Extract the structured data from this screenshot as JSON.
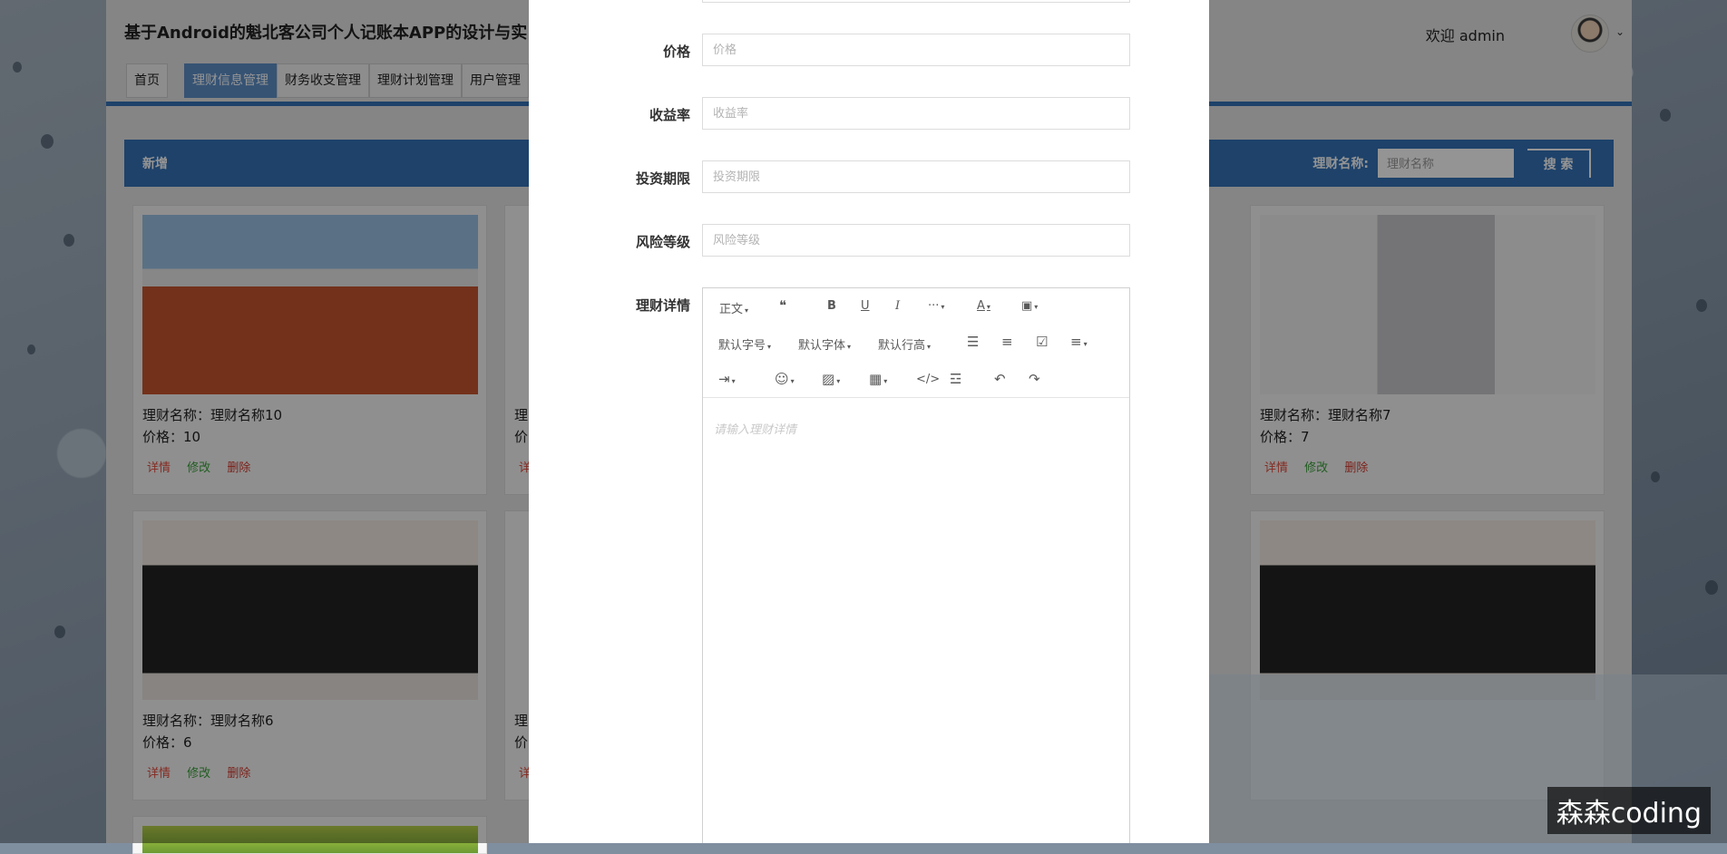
{
  "site": {
    "title": "基于Android的魁北客公司个人记账本APP的设计与实",
    "welcome": "欢迎 admin"
  },
  "nav": {
    "tabs": [
      {
        "label": "首页"
      },
      {
        "label": "理财信息管理",
        "active": true
      },
      {
        "label": "财务收支管理"
      },
      {
        "label": "理财计划管理"
      },
      {
        "label": "用户管理"
      }
    ]
  },
  "toolbar": {
    "add_label": "新增",
    "search_label": "理财名称:",
    "search_placeholder": "理财名称",
    "search_button": "搜 索"
  },
  "cards": [
    {
      "name": "理财名称：理财名称10",
      "price": "价格：10",
      "detail": "详情",
      "edit": "修改",
      "delete": "删除"
    },
    {
      "name": "理财名称：理财名称7",
      "price": "价格：7",
      "detail": "详情",
      "edit": "修改",
      "delete": "删除"
    },
    {
      "name": "理财名称：理财名称6",
      "price": "价格：6",
      "detail": "详情",
      "edit": "修改",
      "delete": "删除"
    }
  ],
  "partial_cards": [
    {
      "name_prefix": "理",
      "price_prefix": "价",
      "action_prefix": "详"
    },
    {
      "name_prefix": "理",
      "price_prefix": "价",
      "action_prefix": "详"
    }
  ],
  "form": {
    "price": {
      "label": "价格",
      "placeholder": "价格"
    },
    "yield": {
      "label": "收益率",
      "placeholder": "收益率"
    },
    "term": {
      "label": "投资期限",
      "placeholder": "投资期限"
    },
    "risk": {
      "label": "风险等级",
      "placeholder": "风险等级"
    },
    "detail": {
      "label": "理财详情",
      "placeholder": "请输入理财详情"
    }
  },
  "editor": {
    "paragraph": "正文",
    "font_size": "默认字号",
    "font_family": "默认字体",
    "line_height": "默认行高"
  },
  "watermark": "森森coding"
}
